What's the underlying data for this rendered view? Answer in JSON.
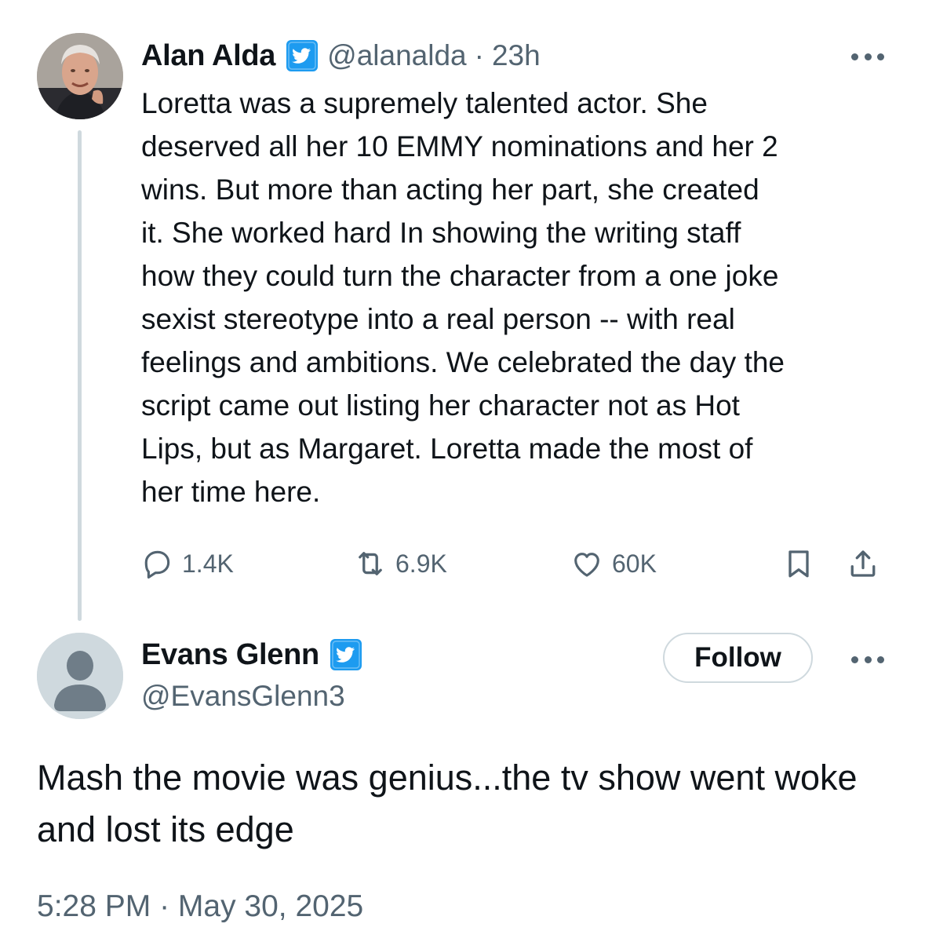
{
  "colors": {
    "text_primary": "#0f1419",
    "text_secondary": "#536471",
    "verified_blue": "#1d9bf0",
    "thread_line": "#cfd9de"
  },
  "parent_tweet": {
    "author_name": "Alan Alda",
    "handle": "@alanalda",
    "separator": "·",
    "time_ago": "23h",
    "text": "Loretta was a supremely talented actor. She\ndeserved all her 10 EMMY nominations and her 2\nwins. But more than acting her part, she created\nit. She worked hard In showing  the writing staff\nhow they could turn the character from a one joke\nsexist stereotype into a real person -- with real\nfeelings and ambitions. We celebrated the day the\nscript came out listing her character not as Hot\nLips, but as Margaret.  Loretta made  the most of\nher time here.",
    "actions": {
      "replies": "1.4K",
      "retweets": "6.9K",
      "likes": "60K"
    },
    "icons": [
      "verified-badge-icon",
      "more-icon",
      "reply-icon",
      "retweet-icon",
      "like-icon",
      "bookmark-icon",
      "share-icon"
    ]
  },
  "reply_tweet": {
    "author_name": "Evans Glenn",
    "handle": "@EvansGlenn3",
    "follow_label": "Follow",
    "text": "Mash the movie was genius...the tv show went woke and lost its edge",
    "timestamp": "5:28 PM · May 30, 2025",
    "icons": [
      "default-avatar-icon",
      "verified-badge-icon",
      "more-icon"
    ]
  }
}
